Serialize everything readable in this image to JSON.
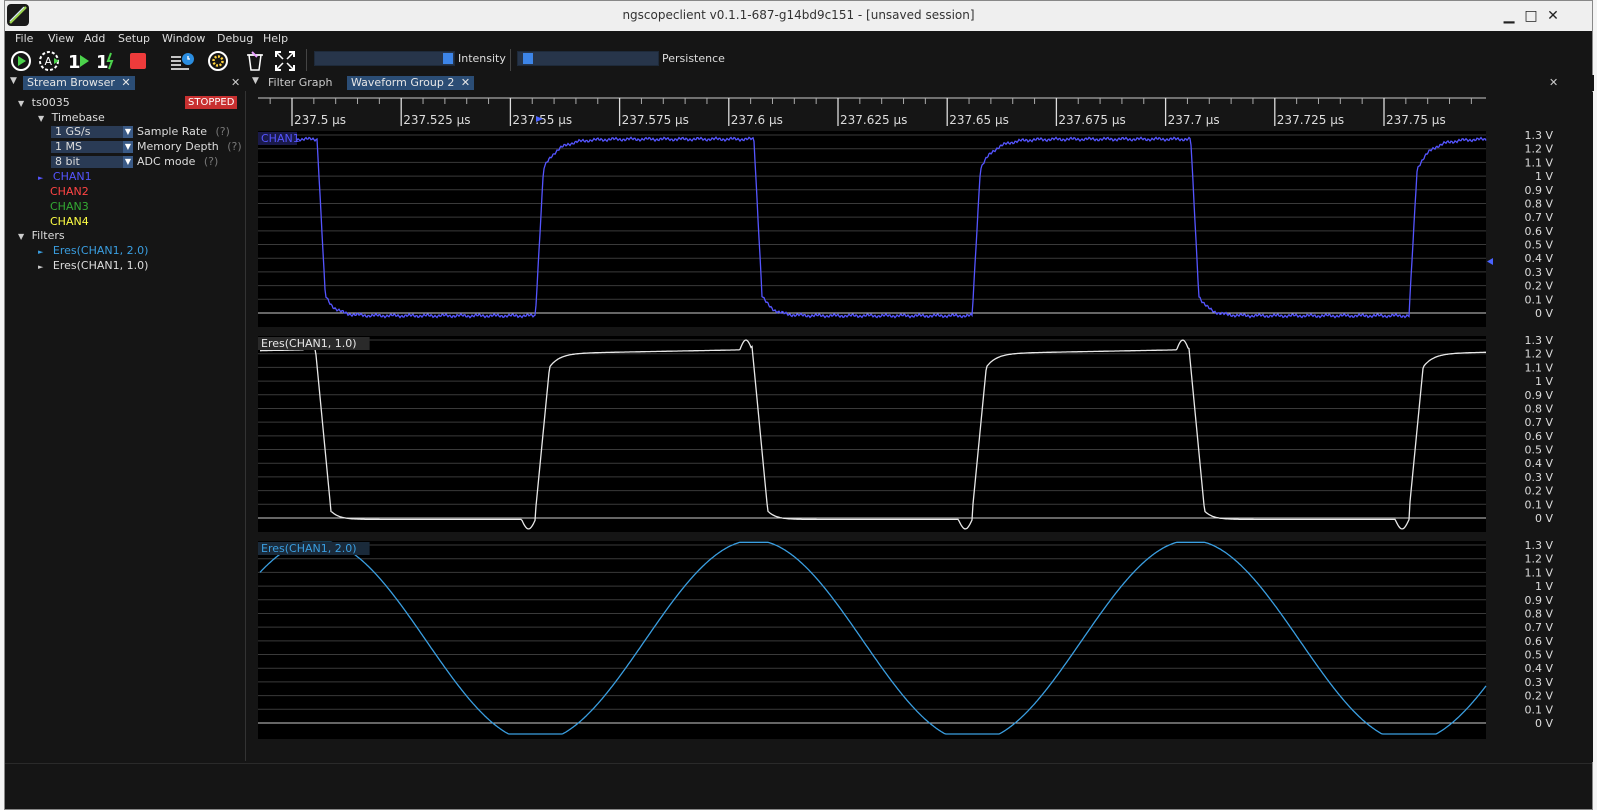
{
  "window": {
    "title": "ngscopeclient v0.1.1-687-g14bd9c151  - [unsaved session]",
    "controls": {
      "minimize": "▁",
      "maximize": "□",
      "close": "✕"
    }
  },
  "menu": [
    "File",
    "View",
    "Add",
    "Setup",
    "Window",
    "Debug",
    "Help"
  ],
  "toolbar": {
    "buttons": [
      "trigger-run-icon",
      "trigger-auto-icon",
      "trigger-single-icon",
      "trigger-force-icon",
      "stop-icon",
      "history-icon",
      "preferences-icon",
      "clear-sweeps-icon",
      "fullscreen-icon"
    ],
    "intensity_label": "Intensity",
    "intensity_value": 0.98,
    "persistence_label": "Persistence",
    "persistence_value": 0.02
  },
  "stream_browser": {
    "tab_label": "Stream Browser",
    "instrument": "ts0035",
    "status": "STOPPED",
    "timebase_label": "Timebase",
    "settings": [
      {
        "value": "1 GS/s",
        "label": "Sample Rate",
        "help": "(?)"
      },
      {
        "value": "1 MS",
        "label": "Memory Depth",
        "help": "(?)"
      },
      {
        "value": "8 bit",
        "label": "ADC mode",
        "help": "(?)"
      }
    ],
    "channels": [
      {
        "name": "CHAN1",
        "color": "#5555ff"
      },
      {
        "name": "CHAN2",
        "color": "#ff4444"
      },
      {
        "name": "CHAN3",
        "color": "#33aa33"
      },
      {
        "name": "CHAN4",
        "color": "#ffff44"
      }
    ],
    "filters_label": "Filters",
    "filters": [
      {
        "name": "Eres(CHAN1, 2.0)",
        "color": "#3a9ee0"
      },
      {
        "name": "Eres(CHAN1, 1.0)",
        "color": "#dddddd"
      }
    ]
  },
  "tabs": {
    "filter_graph": "Filter Graph",
    "waveform_group": "Waveform Group 2"
  },
  "timeline": {
    "ticks": [
      "237.5 µs",
      "237.525 µs",
      "237.55 µs",
      "237.575 µs",
      "237.6 µs",
      "237.625 µs",
      "237.65 µs",
      "237.675 µs",
      "237.7 µs",
      "237.725 µs",
      "237.75 µs"
    ]
  },
  "y_axis_labels": [
    "1.3 V",
    "1.2 V",
    "1.1 V",
    "1 V",
    "0.9 V",
    "0.8 V",
    "0.7 V",
    "0.6 V",
    "0.5 V",
    "0.4 V",
    "0.3 V",
    "0.2 V",
    "0.1 V",
    "0 V"
  ],
  "waveforms": [
    {
      "name": "CHAN1",
      "color": "#5555ff",
      "style": "raw",
      "label_bg": "#1a1a4a"
    },
    {
      "name": "Eres(CHAN1, 1.0)",
      "color": "#e8e8e8",
      "style": "filtered",
      "label_bg": "#2a2a2a"
    },
    {
      "name": "Eres(CHAN1, 2.0)",
      "color": "#3a9ee0",
      "style": "smooth",
      "label_bg": "#1a2a3a"
    }
  ],
  "colors": {
    "background": "#151515",
    "plot_bg": "#000000",
    "accent": "#2b4d75",
    "stopped": "#cc3333"
  }
}
